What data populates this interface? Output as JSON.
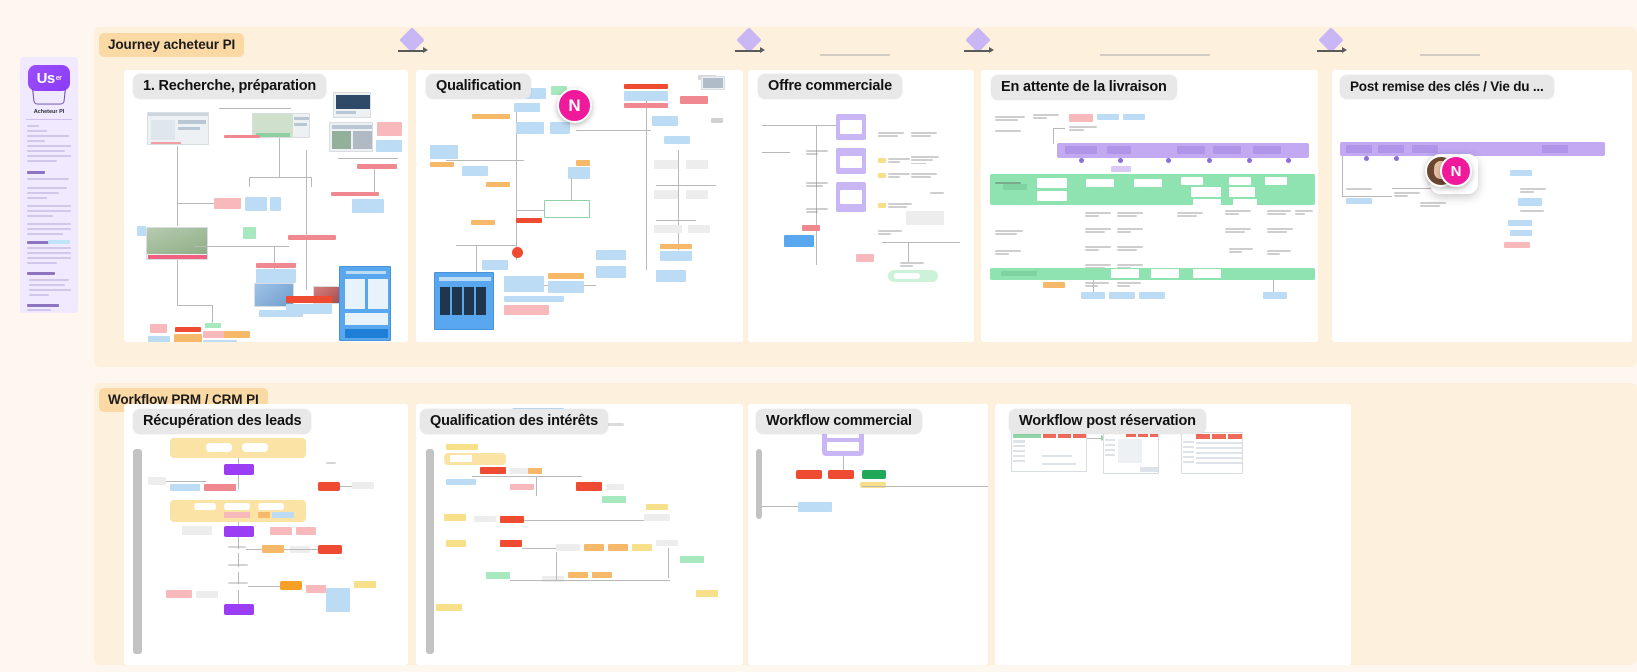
{
  "canvas": {
    "background": "#fdf7ef",
    "section_bg": "#fdf0dd",
    "section_label_bg": "#fbd9a5",
    "frame_bg": "#ffffff",
    "frame_title_bg": "#e8e8e8"
  },
  "persona": {
    "badge_label": "Us",
    "badge_suffix": "er",
    "name": "Acheteur PI",
    "accent": "#8b3cf5",
    "card_bg": "#f0e9ff"
  },
  "sections": [
    {
      "id": "journey",
      "label": "Journey acheteur PI"
    },
    {
      "id": "workflow",
      "label": "Workflow PRM / CRM PI"
    }
  ],
  "frames": [
    {
      "id": "recherche",
      "title": "1. Recherche, préparation",
      "section": "journey"
    },
    {
      "id": "qualification",
      "title": "Qualification",
      "section": "journey"
    },
    {
      "id": "offre",
      "title": "Offre commerciale",
      "section": "journey"
    },
    {
      "id": "attente",
      "title": "En attente de la livraison",
      "section": "journey"
    },
    {
      "id": "post-remise",
      "title": "Post remise des clés / Vie du ...",
      "section": "journey"
    },
    {
      "id": "recuperation",
      "title": "Récupération des leads",
      "section": "workflow"
    },
    {
      "id": "qual-interets",
      "title": "Qualification des intérêts",
      "section": "workflow"
    },
    {
      "id": "wf-commercial",
      "title": "Workflow commercial",
      "section": "workflow"
    },
    {
      "id": "wf-post-resa",
      "title": "Workflow post réservation",
      "section": "workflow"
    }
  ],
  "collaborators": [
    {
      "id": "n-qualification",
      "initial": "N",
      "color": "#f0199c"
    },
    {
      "id": "n-post-remise",
      "initial": "N",
      "color": "#f0199c"
    }
  ],
  "palette": {
    "sticky_blue": "#bcdcf5",
    "sticky_pink": "#f7b9bc",
    "sticky_green": "#a8e8bf",
    "sticky_orange": "#f6b96a",
    "sticky_yellow": "#f8e08a",
    "sticky_purple": "#c9b6f5",
    "sticky_red": "#ef4a32",
    "sticky_violet": "#9b3df5",
    "band_green": "#8fe3b0",
    "band_purple": "#c2a9f2",
    "group_yellow": "#fbe3a6",
    "connector": "#b9b9b9"
  }
}
